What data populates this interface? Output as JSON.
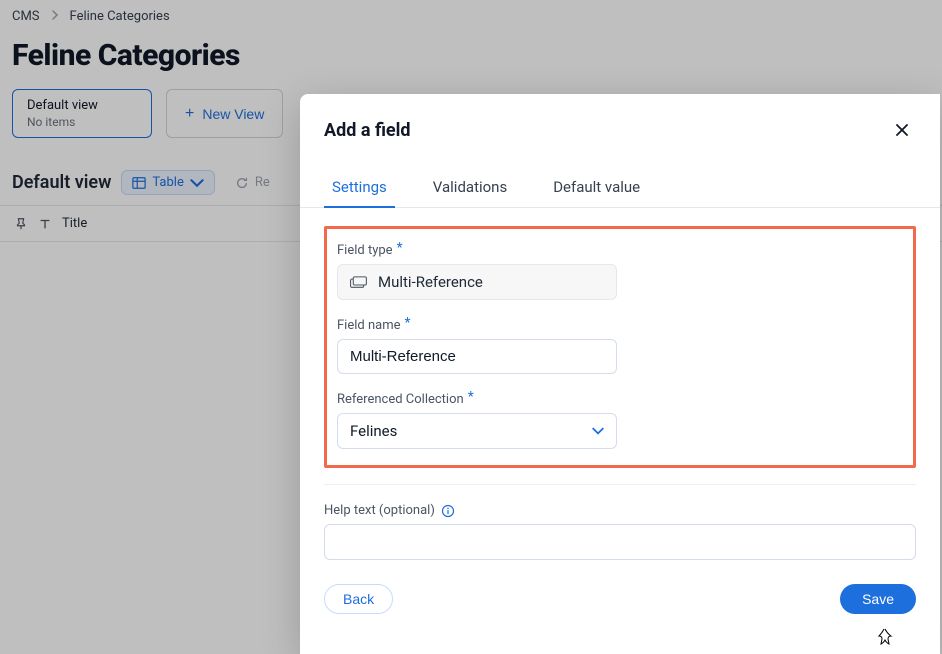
{
  "breadcrumbs": {
    "root": "CMS",
    "current": "Feline Categories"
  },
  "page": {
    "title": "Feline Categories"
  },
  "views": {
    "default_card": {
      "title": "Default view",
      "sub": "No items"
    },
    "new_view_label": "New View"
  },
  "toolbar": {
    "view_title": "Default view",
    "layout_label": "Table",
    "refresh_label": "Re"
  },
  "table": {
    "col_title": "Title"
  },
  "modal": {
    "title": "Add a field",
    "tabs": {
      "settings": "Settings",
      "validations": "Validations",
      "default": "Default value"
    },
    "fields": {
      "type_label": "Field type",
      "type_value": "Multi-Reference",
      "name_label": "Field name",
      "name_value": "Multi-Reference",
      "ref_label": "Referenced Collection",
      "ref_value": "Felines",
      "help_label": "Help text (optional)",
      "help_value": ""
    },
    "buttons": {
      "back": "Back",
      "save": "Save"
    }
  }
}
